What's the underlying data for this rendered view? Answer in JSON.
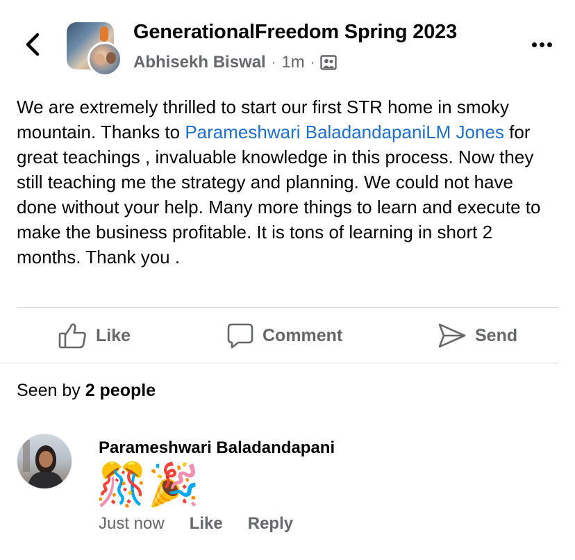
{
  "header": {
    "group_name": "GenerationalFreedom Spring 2023",
    "author": "Abhisekh Biswal",
    "time": "1m",
    "separator": "·",
    "back_icon": "chevron-left-icon",
    "audience_icon": "group-audience-icon",
    "more_icon": "more-horizontal-icon"
  },
  "post": {
    "text_before": "We are extremely thrilled to start our first STR home in smoky mountain. Thanks to ",
    "mention_1": "Parameshwari Baladandapani",
    "mention_2": "LM Jones",
    "text_after": " for great teachings , invaluable knowledge in this process. Now they still teaching me the strategy and planning. We could not have done without your help. Many more things to learn and execute to make the business profitable. It is tons of learning in short 2 months. Thank you ."
  },
  "actions": {
    "like": "Like",
    "comment": "Comment",
    "send": "Send"
  },
  "seen": {
    "prefix": "Seen by ",
    "count": "2 people"
  },
  "comment": {
    "name": "Parameshwari Baladandapani",
    "emojis": "🎊🎉",
    "time": "Just now",
    "like": "Like",
    "reply": "Reply"
  },
  "colors": {
    "mention": "#1b6fd1",
    "secondary_text": "#65676b",
    "primary_text": "#050505",
    "divider": "#d6d6d6"
  }
}
